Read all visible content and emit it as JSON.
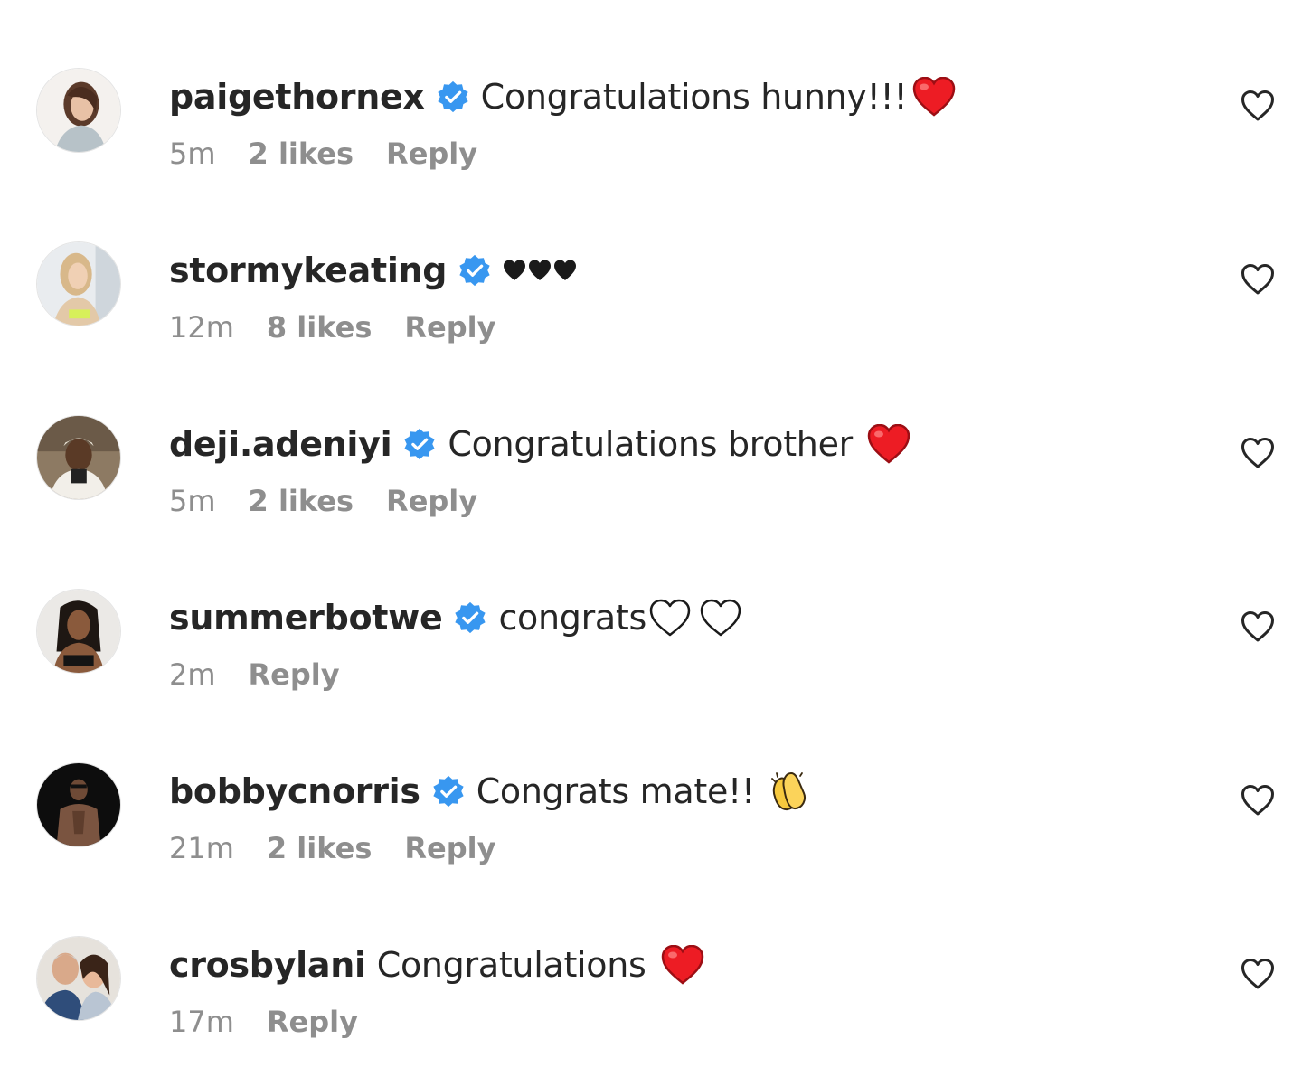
{
  "comments": [
    {
      "username": "paigethornex",
      "verified": true,
      "text": "Congratulations hunny!!!",
      "emoji": "red-heart",
      "time": "5m",
      "likes": "2 likes",
      "reply": "Reply"
    },
    {
      "username": "stormykeating",
      "verified": true,
      "text": "",
      "emoji": "three-black-hearts",
      "time": "12m",
      "likes": "8 likes",
      "reply": "Reply"
    },
    {
      "username": "deji.adeniyi",
      "verified": true,
      "text": "Congratulations brother",
      "emoji": "red-heart",
      "time": "5m",
      "likes": "2 likes",
      "reply": "Reply"
    },
    {
      "username": "summerbotwe",
      "verified": true,
      "text": "congrats",
      "emoji": "two-white-hearts",
      "time": "2m",
      "likes": "",
      "reply": "Reply"
    },
    {
      "username": "bobbycnorris",
      "verified": true,
      "text": "Congrats mate!!",
      "emoji": "clapping-hands",
      "time": "21m",
      "likes": "2 likes",
      "reply": "Reply"
    },
    {
      "username": "crosbylani",
      "verified": false,
      "text": "Congratulations",
      "emoji": "red-heart",
      "time": "17m",
      "likes": "",
      "reply": "Reply"
    }
  ],
  "colors": {
    "verified_badge": "#3897f0",
    "meta_text": "#8e8e8e",
    "primary_text": "#262626",
    "red_heart": "#ed1c24"
  },
  "icons": {
    "like": "heart-outline-icon",
    "verified": "verified-badge-icon"
  }
}
